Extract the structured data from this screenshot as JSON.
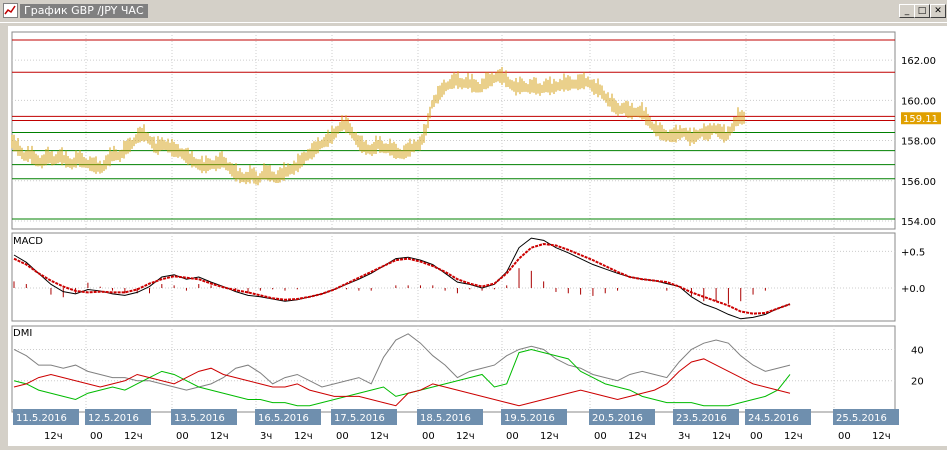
{
  "window": {
    "title": "График GBP /JPY  ЧАС",
    "buttons": {
      "minimize": "_",
      "maximize": "□",
      "close": "✕"
    }
  },
  "colors": {
    "price": "#d4a017",
    "resistance": "#c00000",
    "support": "#008000",
    "macd_line": "#000000",
    "signal": "#cc0000",
    "hist": "#aa0000",
    "dmi_adx": "#808080",
    "dmi_plus": "#00bb00",
    "dmi_minus": "#cc0000",
    "date_box": "#6f8fae",
    "price_tag": "#e0a000"
  },
  "chart_data": [
    {
      "type": "line",
      "name": "price",
      "title": "",
      "ylim": [
        153.6,
        163.4
      ],
      "yticks": [
        "162.00",
        "160.00",
        "158.00",
        "156.00",
        "154.00"
      ],
      "last_price_label": "159.11",
      "horizontal_lines": {
        "red": [
          163.0,
          161.4,
          159.2,
          159.0
        ],
        "green": [
          158.4,
          157.5,
          156.8,
          156.1,
          154.1
        ]
      },
      "x": [
        0,
        6,
        12,
        18,
        24,
        30,
        36,
        42,
        48,
        54,
        60,
        66,
        72,
        78,
        84,
        90,
        96,
        102,
        108,
        114,
        120,
        126,
        132,
        138,
        144,
        150,
        156,
        162,
        168,
        174,
        180,
        186,
        192,
        198,
        204,
        210,
        216,
        222,
        228,
        234,
        240,
        246,
        252,
        258,
        264,
        270,
        276,
        282,
        288,
        294,
        300,
        306,
        312,
        318,
        324,
        330,
        336,
        342,
        348,
        354,
        360,
        366,
        372,
        378,
        384,
        390,
        396,
        402,
        408,
        414,
        420,
        426,
        432,
        438,
        444,
        450,
        456,
        462,
        468,
        474,
        480,
        486,
        492,
        498,
        504,
        510,
        516,
        522,
        528,
        534,
        540,
        546,
        552,
        558,
        564,
        570,
        576,
        582,
        588,
        594,
        600,
        606,
        612,
        618,
        624,
        630,
        636,
        642,
        648,
        654,
        660,
        666,
        672,
        678,
        684,
        690,
        696,
        702,
        708,
        714,
        720,
        726,
        732,
        738,
        744,
        750,
        756,
        762,
        768,
        774,
        780
      ],
      "y": [
        157.9,
        157.6,
        157.2,
        157.3,
        157.0,
        156.9,
        157.2,
        157.0,
        157.2,
        157.0,
        156.8,
        157.1,
        156.9,
        156.8,
        156.7,
        156.6,
        157.0,
        157.3,
        157.2,
        157.6,
        157.8,
        158.2,
        158.3,
        158.0,
        157.6,
        157.8,
        157.7,
        157.5,
        157.4,
        157.2,
        157.0,
        156.8,
        156.7,
        156.8,
        156.8,
        157.0,
        156.7,
        156.4,
        156.2,
        156.1,
        156.3,
        156.0,
        156.4,
        156.3,
        156.1,
        156.3,
        156.5,
        156.6,
        156.9,
        157.2,
        157.4,
        157.7,
        157.9,
        158.1,
        158.4,
        158.8,
        158.7,
        158.2,
        157.8,
        157.6,
        157.5,
        157.8,
        157.6,
        157.6,
        157.4,
        157.3,
        157.5,
        157.7,
        157.8,
        158.5,
        159.8,
        160.2,
        160.6,
        160.8,
        161.0,
        160.8,
        160.9,
        160.7,
        160.6,
        160.9,
        161.0,
        161.2,
        161.1,
        160.8,
        160.6,
        160.7,
        160.6,
        160.7,
        160.5,
        160.7,
        160.6,
        160.7,
        160.8,
        160.8,
        160.8,
        160.9,
        160.9,
        160.6,
        160.5,
        160.1,
        159.8,
        159.5,
        159.6,
        159.4,
        159.4,
        159.4,
        159.0,
        158.6,
        158.4,
        158.2,
        158.2,
        158.3,
        158.4,
        158.1,
        158.2,
        158.4,
        158.3,
        158.6,
        158.4,
        158.2,
        158.6,
        159.1,
        159.1,
        159.1,
        159.1,
        159.1,
        159.1,
        159.1,
        159.1,
        159.1,
        159.1
      ]
    },
    {
      "type": "line",
      "name": "macd",
      "title": "MACD",
      "ylim": [
        -0.45,
        0.75
      ],
      "yticks": [
        "+0.5",
        "+0.0"
      ],
      "series": [
        {
          "role": "macd",
          "values": [
            0.45,
            0.35,
            0.2,
            0.05,
            -0.05,
            -0.08,
            -0.02,
            -0.04,
            -0.08,
            -0.1,
            -0.06,
            0.02,
            0.15,
            0.18,
            0.12,
            0.15,
            0.08,
            0.02,
            -0.05,
            -0.1,
            -0.12,
            -0.15,
            -0.18,
            -0.16,
            -0.12,
            -0.08,
            -0.02,
            0.05,
            0.12,
            0.2,
            0.3,
            0.4,
            0.42,
            0.38,
            0.32,
            0.2,
            0.08,
            0.05,
            0.0,
            0.05,
            0.22,
            0.55,
            0.68,
            0.65,
            0.55,
            0.48,
            0.4,
            0.32,
            0.26,
            0.2,
            0.15,
            0.12,
            0.1,
            0.06,
            0.02,
            -0.12,
            -0.22,
            -0.28,
            -0.36,
            -0.42,
            -0.4,
            -0.36,
            -0.28,
            -0.22
          ]
        },
        {
          "role": "signal",
          "values": [
            0.4,
            0.32,
            0.2,
            0.1,
            0.02,
            -0.04,
            -0.06,
            -0.05,
            -0.06,
            -0.06,
            -0.02,
            0.06,
            0.12,
            0.16,
            0.14,
            0.12,
            0.06,
            0.01,
            -0.03,
            -0.06,
            -0.1,
            -0.14,
            -0.16,
            -0.15,
            -0.12,
            -0.08,
            -0.02,
            0.06,
            0.14,
            0.22,
            0.3,
            0.38,
            0.4,
            0.36,
            0.3,
            0.22,
            0.12,
            0.06,
            0.02,
            0.06,
            0.2,
            0.4,
            0.55,
            0.6,
            0.58,
            0.52,
            0.45,
            0.38,
            0.3,
            0.22,
            0.15,
            0.12,
            0.1,
            0.08,
            0.02,
            -0.06,
            -0.12,
            -0.18,
            -0.24,
            -0.32,
            -0.35,
            -0.34,
            -0.28,
            -0.22
          ]
        }
      ]
    },
    {
      "type": "line",
      "name": "dmi",
      "title": "DMI",
      "ylim": [
        0,
        55
      ],
      "yticks": [
        "40",
        "20"
      ],
      "series": [
        {
          "role": "adx",
          "values": [
            40,
            36,
            30,
            30,
            28,
            30,
            26,
            24,
            22,
            22,
            20,
            20,
            18,
            16,
            14,
            16,
            18,
            22,
            28,
            30,
            25,
            18,
            22,
            24,
            20,
            16,
            18,
            20,
            22,
            18,
            35,
            46,
            50,
            44,
            36,
            30,
            22,
            26,
            28,
            30,
            36,
            40,
            42,
            40,
            34,
            30,
            28,
            24,
            22,
            20,
            24,
            26,
            24,
            22,
            32,
            40,
            44,
            46,
            44,
            36,
            30,
            26,
            28,
            30
          ]
        },
        {
          "role": "plus_di",
          "values": [
            20,
            18,
            14,
            12,
            10,
            8,
            12,
            14,
            16,
            14,
            18,
            22,
            26,
            24,
            20,
            16,
            14,
            12,
            10,
            8,
            8,
            6,
            6,
            4,
            4,
            6,
            8,
            10,
            12,
            14,
            16,
            10,
            12,
            14,
            16,
            18,
            20,
            22,
            24,
            16,
            18,
            38,
            40,
            38,
            36,
            34,
            26,
            22,
            18,
            16,
            14,
            10,
            8,
            6,
            6,
            6,
            4,
            4,
            4,
            6,
            8,
            10,
            14,
            24
          ]
        },
        {
          "role": "minus_di",
          "values": [
            16,
            18,
            22,
            24,
            22,
            20,
            18,
            16,
            18,
            20,
            24,
            22,
            20,
            18,
            22,
            26,
            28,
            24,
            22,
            20,
            18,
            16,
            16,
            18,
            14,
            12,
            10,
            10,
            10,
            8,
            6,
            4,
            12,
            14,
            18,
            16,
            14,
            12,
            10,
            8,
            6,
            4,
            6,
            8,
            10,
            12,
            14,
            12,
            10,
            8,
            10,
            12,
            14,
            18,
            26,
            32,
            34,
            30,
            26,
            22,
            18,
            16,
            14,
            12
          ]
        }
      ]
    }
  ],
  "xaxis": {
    "dates": [
      "11.5.2016",
      "12.5.2016",
      "13.5.2016",
      "16.5.2016",
      "17.5.2016",
      "18.5.2016",
      "19.5.2016",
      "20.5.2016",
      "23.5.2016",
      "24.5.2016",
      "25.5.2016"
    ],
    "hours": [
      [
        "12ч"
      ],
      [
        "00",
        "12ч"
      ],
      [
        "00",
        "12ч"
      ],
      [
        "3ч",
        "12ч"
      ],
      [
        "00",
        "12ч"
      ],
      [
        "00",
        "12ч"
      ],
      [
        "00",
        "12ч"
      ],
      [
        "00",
        "12ч"
      ],
      [
        "3ч",
        "12ч"
      ],
      [
        "00",
        "12ч"
      ],
      [
        "00",
        "12ч"
      ]
    ]
  }
}
